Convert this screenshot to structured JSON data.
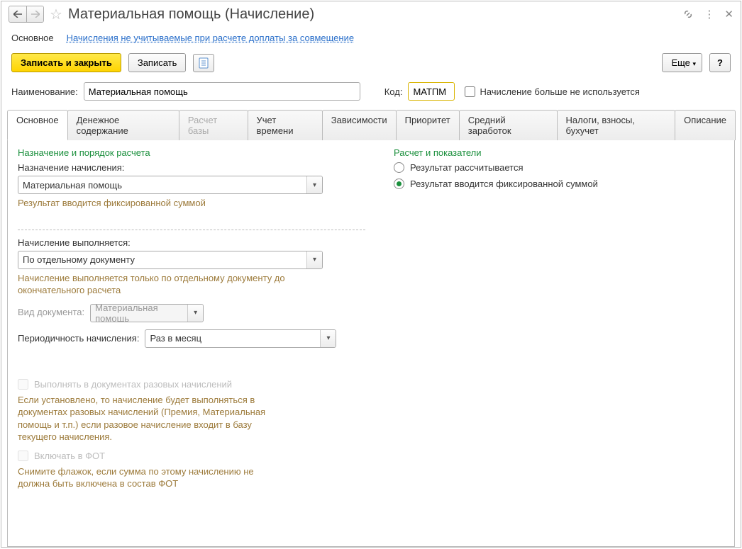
{
  "title": "Материальная помощь (Начисление)",
  "navlinks": {
    "main": "Основное",
    "other": "Начисления не учитываемые при расчете доплаты за совмещение"
  },
  "toolbar": {
    "write_close": "Записать и закрыть",
    "write": "Записать",
    "more": "Еще",
    "help": "?"
  },
  "fields": {
    "name_label": "Наименование:",
    "name_value": "Материальная помощь",
    "code_label": "Код:",
    "code_value": "МАТПМ",
    "not_used_label": "Начисление больше не используется"
  },
  "tabs": [
    {
      "label": "Основное",
      "state": "active"
    },
    {
      "label": "Денежное содержание",
      "state": ""
    },
    {
      "label": "Расчет базы",
      "state": "disabled"
    },
    {
      "label": "Учет времени",
      "state": ""
    },
    {
      "label": "Зависимости",
      "state": ""
    },
    {
      "label": "Приоритет",
      "state": ""
    },
    {
      "label": "Средний заработок",
      "state": ""
    },
    {
      "label": "Налоги, взносы, бухучет",
      "state": ""
    },
    {
      "label": "Описание",
      "state": ""
    }
  ],
  "left": {
    "section1_title": "Назначение и порядок расчета",
    "assign_label": "Назначение начисления:",
    "assign_value": "Материальная помощь",
    "assign_hint": "Результат вводится фиксированной суммой",
    "exec_label": "Начисление выполняется:",
    "exec_value": "По отдельному документу",
    "exec_hint": "Начисление выполняется только по отдельному документу до окончательного расчета",
    "doc_type_label": "Вид документа:",
    "doc_type_value": "Материальная помощь",
    "period_label": "Периодичность начисления:",
    "period_value": "Раз в месяц",
    "once_chk": "Выполнять в документах разовых начислений",
    "once_hint": "Если установлено, то начисление будет выполняться в документах разовых начислений (Премия, Материальная помощь и т.п.) если разовое начисление входит в базу текущего начисления.",
    "fot_chk": "Включать в ФОТ",
    "fot_hint": "Снимите флажок, если сумма по этому начислению не должна быть включена в состав ФОТ"
  },
  "right": {
    "section_title": "Расчет и показатели",
    "radio_calc": "Результат рассчитывается",
    "radio_fixed": "Результат вводится фиксированной суммой"
  }
}
